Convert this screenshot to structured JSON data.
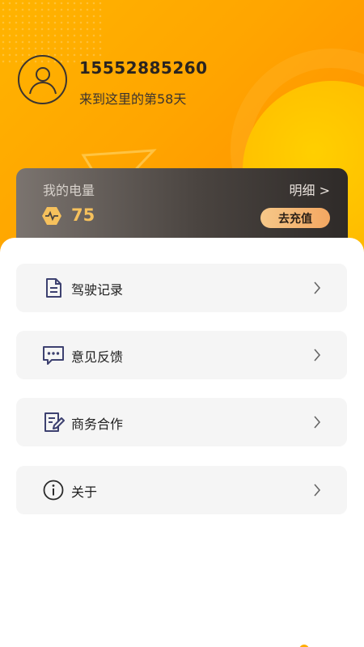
{
  "profile": {
    "phone": "15552885260",
    "days_text": "来到这里的第58天"
  },
  "energy": {
    "label": "我的电量",
    "detail_link": "明细 >",
    "value": "75",
    "recharge_label": "去充值"
  },
  "menu": [
    {
      "label": "驾驶记录",
      "icon": "document-icon"
    },
    {
      "label": "意见反馈",
      "icon": "chat-bubble-icon"
    },
    {
      "label": "商务合作",
      "icon": "edit-document-icon"
    },
    {
      "label": "关于",
      "icon": "info-icon"
    }
  ],
  "colors": {
    "header_orange": "#ffa500",
    "accent_yellow": "#f6c15c",
    "card_dark": "#2e2a28",
    "menu_bg": "#f5f5f5",
    "icon_navy": "#3d4170"
  }
}
